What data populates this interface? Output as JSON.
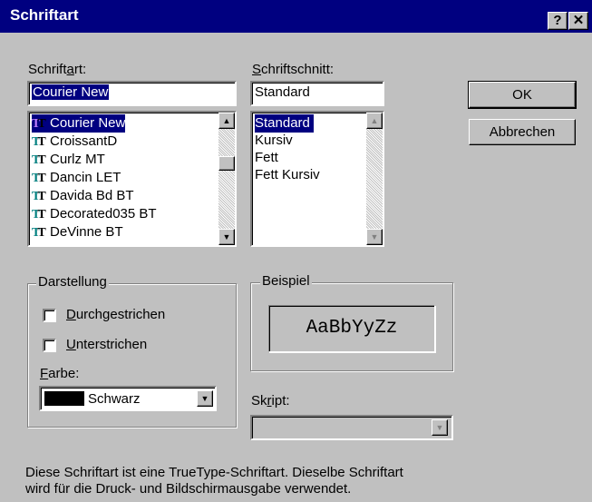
{
  "window": {
    "title": "Schriftart",
    "help_button": "?",
    "close_button": "✕"
  },
  "font": {
    "label": "Schriftart:",
    "value": "Courier New",
    "items": [
      "Courier New",
      "CroissantD",
      "Curlz MT",
      "Dancin LET",
      "Davida Bd BT",
      "Decorated035 BT",
      "DeVinne BT"
    ],
    "selected_index": 0,
    "item_icon": "truetype-icon"
  },
  "style": {
    "label": "Schriftschnitt:",
    "value": "Standard",
    "items": [
      "Standard",
      "Kursiv",
      "Fett",
      "Fett Kursiv"
    ],
    "selected_index": 0
  },
  "buttons": {
    "ok": "OK",
    "cancel": "Abbrechen"
  },
  "effects": {
    "group_label": "Darstellung",
    "strikethrough": "Durchgestrichen",
    "strikethrough_checked": false,
    "underline": "Unterstrichen",
    "underline_checked": false,
    "color_label": "Farbe:",
    "color_value": "Schwarz",
    "color_swatch": "#000000"
  },
  "sample": {
    "group_label": "Beispiel",
    "text": "AaBbYyZz"
  },
  "script": {
    "label": "Skript:",
    "value": ""
  },
  "description": {
    "line1": "Diese Schriftart ist eine TrueType-Schriftart. Dieselbe Schriftart",
    "line2": "wird für die Druck- und Bildschirmausgabe verwendet."
  }
}
